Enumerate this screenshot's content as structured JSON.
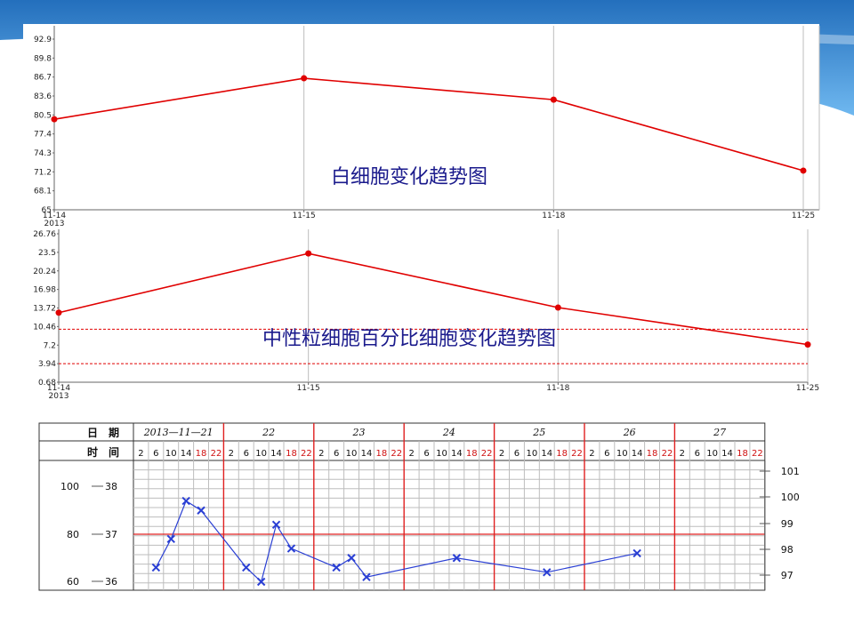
{
  "theme": {
    "banner": "#1e7fd0",
    "line": "#e00000",
    "grid": "#bdbdbd",
    "temp": "#2a3fd4",
    "day_sep": "#e02020"
  },
  "chart_data": [
    {
      "type": "line",
      "title": "白细胞变化趋势图",
      "x": [
        "11-14",
        "11-15",
        "11-18",
        "11-25"
      ],
      "year_label": "2013",
      "yticks": [
        "65",
        "68.1",
        "71.2",
        "74.3",
        "77.4",
        "80.5",
        "83.6",
        "86.7",
        "89.8",
        "92.9"
      ],
      "ylim": [
        65,
        92.9
      ],
      "series": [
        {
          "values": [
            79.8,
            86.5,
            83.0,
            71.4
          ]
        }
      ],
      "grid": "vertical"
    },
    {
      "type": "line",
      "title": "中性粒细胞百分比细胞变化趋势图",
      "x": [
        "11-14",
        "11-15",
        "11-18",
        "11-25"
      ],
      "year_label": "2013",
      "yticks": [
        "0.68",
        "3.94",
        "7.2",
        "10.46",
        "13.72",
        "16.98",
        "20.24",
        "23.5",
        "26.76"
      ],
      "ylim": [
        0.68,
        26.76
      ],
      "ref_lines": [
        10.0,
        3.94
      ],
      "series": [
        {
          "values": [
            12.9,
            23.3,
            13.8,
            7.3
          ]
        }
      ],
      "grid": "vertical"
    },
    {
      "type": "line",
      "row_labels": {
        "date": "日　期",
        "time": "时　间"
      },
      "days": [
        "2013—11—21",
        "22",
        "23",
        "24",
        "25",
        "26",
        "27"
      ],
      "slots": [
        "2",
        "6",
        "10",
        "14",
        "18",
        "22"
      ],
      "left_scale_outer": [
        "100",
        "80",
        "60"
      ],
      "left_scale_inner": [
        "38",
        "37",
        "36"
      ],
      "right_scale": [
        "101",
        "100",
        "99",
        "98",
        "97"
      ],
      "ylim": [
        35.8,
        38.6
      ],
      "ref_line": 37,
      "series": [
        {
          "marker": "x",
          "values": [
            [
              null,
              36.3,
              36.9,
              37.7,
              37.5,
              null
            ],
            [
              null,
              36.3,
              36.0,
              37.2,
              36.7,
              null
            ],
            [
              null,
              36.3,
              36.5,
              36.1,
              null,
              null
            ],
            [
              null,
              null,
              null,
              36.5,
              null,
              null
            ],
            [
              null,
              null,
              null,
              36.2,
              null,
              null
            ],
            [
              null,
              null,
              null,
              36.6,
              null,
              null
            ],
            [
              null,
              null,
              null,
              null,
              null,
              null
            ]
          ]
        }
      ]
    }
  ]
}
